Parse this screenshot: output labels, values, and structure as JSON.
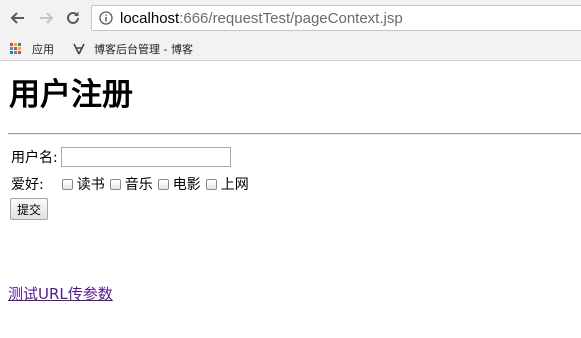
{
  "browser": {
    "url_host": "localhost",
    "url_rest": ":666/requestTest/pageContext.jsp",
    "bookmarks": [
      {
        "label": "应用",
        "icon": "apps-grid-icon"
      },
      {
        "label": "博客后台管理 - 博客",
        "icon": "blog-favicon-icon"
      }
    ],
    "nav_icons": [
      "back-arrow-icon",
      "forward-arrow-icon",
      "reload-icon",
      "info-icon"
    ]
  },
  "page": {
    "title": "用户注册",
    "form": {
      "username_label": "用户名:",
      "username_value": "",
      "hobby_label": "爱好:",
      "hobbies": [
        {
          "label": "读书",
          "checked": false
        },
        {
          "label": "音乐",
          "checked": false
        },
        {
          "label": "电影",
          "checked": false
        },
        {
          "label": "上网",
          "checked": false
        }
      ],
      "submit_label": "提交"
    },
    "link_text": "测试URL传参数"
  },
  "colors": {
    "chrome_background": "#f2f2f2",
    "link_visited": "#551a8b",
    "url_dim": "#6b6b6b"
  }
}
